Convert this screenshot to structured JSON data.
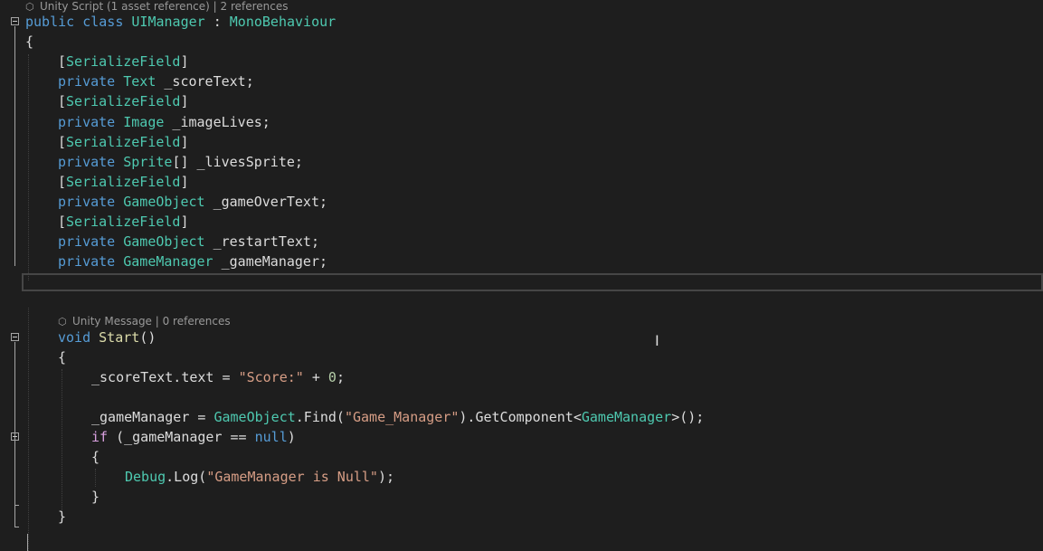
{
  "lens_class": {
    "icon": "unity-icon",
    "text": "Unity Script (1 asset reference) | 2 references"
  },
  "lens_start": {
    "icon": "unity-icon",
    "text": "Unity Message | 0 references"
  },
  "code": {
    "l1": [
      "public",
      " ",
      "class",
      " ",
      "UIManager",
      " : ",
      "MonoBehaviour"
    ],
    "l2": "{",
    "l3": [
      "[",
      "SerializeField",
      "]"
    ],
    "l4": [
      "private",
      " ",
      "Text",
      " _scoreText;"
    ],
    "l5": [
      "[",
      "SerializeField",
      "]"
    ],
    "l6": [
      "private",
      " ",
      "Image",
      " _imageLives;"
    ],
    "l7": [
      "[",
      "SerializeField",
      "]"
    ],
    "l8": [
      "private",
      " ",
      "Sprite",
      "[] _livesSprite;"
    ],
    "l9": [
      "[",
      "SerializeField",
      "]"
    ],
    "l10": [
      "private",
      " ",
      "GameObject",
      " _gameOverText;"
    ],
    "l11": [
      "[",
      "SerializeField",
      "]"
    ],
    "l12": [
      "private",
      " ",
      "GameObject",
      " _restartText;"
    ],
    "l13": [
      "private",
      " ",
      "GameManager",
      " _gameManager;"
    ],
    "l14": [
      "void",
      " ",
      "Start",
      "()"
    ],
    "l15": "{",
    "l16": [
      "_scoreText.text = ",
      "\"Score:\"",
      " + ",
      "0",
      ";"
    ],
    "l17": [
      "_gameManager = ",
      "GameObject",
      ".Find(",
      "\"Game_Manager\"",
      ").GetComponent<",
      "GameManager",
      ">();"
    ],
    "l18": [
      "if",
      " (_gameManager == ",
      "null",
      ")"
    ],
    "l19": "{",
    "l20": [
      "Debug",
      ".Log(",
      "\"GameManager is Null\"",
      ");"
    ],
    "l21": "}",
    "l22": "}"
  },
  "colors": {
    "background": "#1e1e1e",
    "keyword": "#569cd6",
    "type": "#4ec9b0",
    "string": "#d69d85",
    "number": "#b5cea8",
    "control": "#d8a0df",
    "text": "#dcdcdc"
  }
}
